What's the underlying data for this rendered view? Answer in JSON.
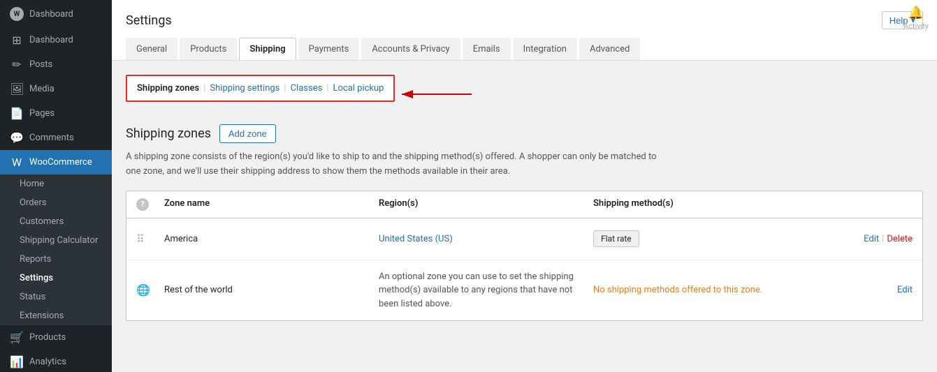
{
  "sidebar": {
    "logo": {
      "label": "Dashboard"
    },
    "items": [
      {
        "id": "dashboard",
        "label": "Dashboard",
        "icon": "⊞"
      },
      {
        "id": "posts",
        "label": "Posts",
        "icon": "✏"
      },
      {
        "id": "media",
        "label": "Media",
        "icon": "🖼"
      },
      {
        "id": "pages",
        "label": "Pages",
        "icon": "📄"
      },
      {
        "id": "comments",
        "label": "Comments",
        "icon": "💬"
      },
      {
        "id": "woocommerce",
        "label": "WooCommerce",
        "icon": "W",
        "active": true
      },
      {
        "id": "home",
        "label": "Home",
        "sub": true
      },
      {
        "id": "orders",
        "label": "Orders",
        "sub": true
      },
      {
        "id": "customers",
        "label": "Customers",
        "sub": true
      },
      {
        "id": "shipping-calculator",
        "label": "Shipping Calculator",
        "sub": true
      },
      {
        "id": "reports",
        "label": "Reports",
        "sub": true
      },
      {
        "id": "settings",
        "label": "Settings",
        "sub": true,
        "activeSub": true
      },
      {
        "id": "status",
        "label": "Status",
        "sub": true
      },
      {
        "id": "extensions",
        "label": "Extensions",
        "sub": true
      },
      {
        "id": "products",
        "label": "Products",
        "icon": "🛒"
      },
      {
        "id": "analytics",
        "label": "Analytics",
        "icon": "📊"
      }
    ]
  },
  "topbar": {
    "activity_label": "Activity"
  },
  "header": {
    "title": "Settings",
    "help_label": "Help",
    "tabs": [
      {
        "id": "general",
        "label": "General"
      },
      {
        "id": "products",
        "label": "Products"
      },
      {
        "id": "shipping",
        "label": "Shipping",
        "active": true
      },
      {
        "id": "payments",
        "label": "Payments"
      },
      {
        "id": "accounts-privacy",
        "label": "Accounts & Privacy"
      },
      {
        "id": "emails",
        "label": "Emails"
      },
      {
        "id": "integration",
        "label": "Integration"
      },
      {
        "id": "advanced",
        "label": "Advanced"
      }
    ]
  },
  "subnav": {
    "items": [
      {
        "id": "shipping-zones",
        "label": "Shipping zones",
        "active": true
      },
      {
        "id": "shipping-settings",
        "label": "Shipping settings"
      },
      {
        "id": "classes",
        "label": "Classes"
      },
      {
        "id": "local-pickup",
        "label": "Local pickup"
      }
    ]
  },
  "content": {
    "section_title": "Shipping zones",
    "add_zone_btn": "Add zone",
    "description": "A shipping zone consists of the region(s) you'd like to ship to and the shipping method(s) offered. A shopper can only be matched to one zone, and we'll use their shipping address to show them the methods available in their area.",
    "table": {
      "columns": [
        {
          "id": "drag",
          "label": ""
        },
        {
          "id": "zone-name",
          "label": "Zone name"
        },
        {
          "id": "regions",
          "label": "Region(s)"
        },
        {
          "id": "shipping-methods",
          "label": "Shipping method(s)"
        },
        {
          "id": "actions",
          "label": ""
        }
      ],
      "rows": [
        {
          "id": "america",
          "drag": true,
          "zone_name": "America",
          "region": "United States (US)",
          "shipping_method": "Flat rate",
          "edit_label": "Edit",
          "delete_label": "Delete"
        },
        {
          "id": "rest-of-world",
          "drag": false,
          "icon": "🌐",
          "zone_name": "Rest of the world",
          "region_desc": "An optional zone you can use to set the shipping method(s) available to any regions that have not been listed above.",
          "no_methods_label": "No shipping methods offered to this zone.",
          "edit_label": "Edit"
        }
      ]
    }
  }
}
